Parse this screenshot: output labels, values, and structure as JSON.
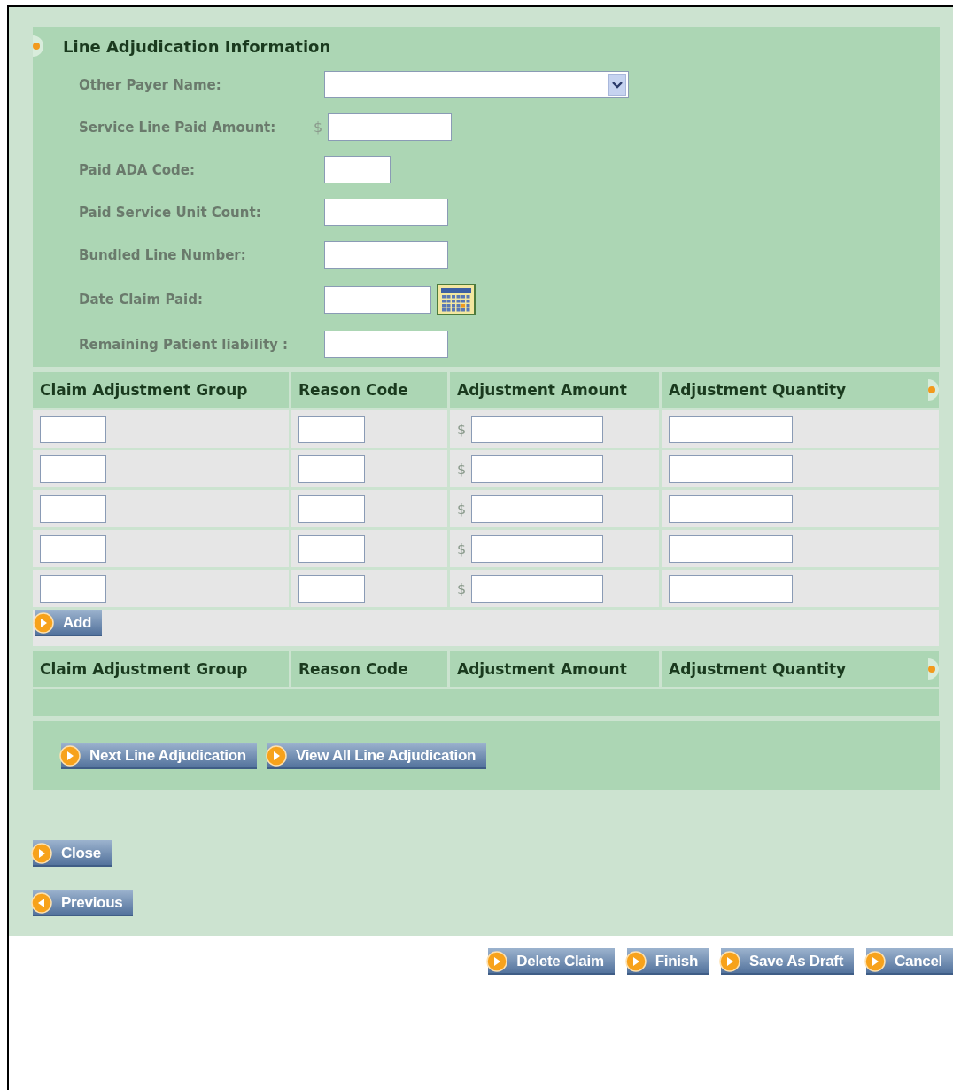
{
  "section": {
    "title": "Line Adjudication Information",
    "fields": [
      {
        "label": "Other Payer Name:",
        "kind": "select"
      },
      {
        "label": "Service Line Paid Amount:",
        "kind": "money",
        "prefix": "$"
      },
      {
        "label": "Paid ADA Code:",
        "kind": "short"
      },
      {
        "label": "Paid Service Unit Count:",
        "kind": "text"
      },
      {
        "label": "Bundled Line Number:",
        "kind": "text"
      },
      {
        "label": "Date Claim Paid:",
        "kind": "date"
      },
      {
        "label": "Remaining Patient liability :",
        "kind": "text"
      }
    ]
  },
  "adjustments": {
    "columns": [
      "Claim Adjustment Group",
      "Reason Code",
      "Adjustment Amount",
      "Adjustment Quantity"
    ],
    "rows": [
      {
        "cells": [
          {
            "kind": "short"
          },
          {
            "kind": "short"
          },
          {
            "kind": "money",
            "prefix": "$"
          },
          {
            "kind": "text"
          }
        ]
      },
      {
        "cells": [
          {
            "kind": "short"
          },
          {
            "kind": "short"
          },
          {
            "kind": "money",
            "prefix": "$"
          },
          {
            "kind": "text"
          }
        ]
      },
      {
        "cells": [
          {
            "kind": "short"
          },
          {
            "kind": "short"
          },
          {
            "kind": "money",
            "prefix": "$"
          },
          {
            "kind": "text"
          }
        ]
      },
      {
        "cells": [
          {
            "kind": "short"
          },
          {
            "kind": "short"
          },
          {
            "kind": "money",
            "prefix": "$"
          },
          {
            "kind": "text"
          }
        ]
      },
      {
        "cells": [
          {
            "kind": "short"
          },
          {
            "kind": "short"
          },
          {
            "kind": "money",
            "prefix": "$"
          },
          {
            "kind": "text"
          }
        ]
      }
    ],
    "add_button": {
      "label": "Add",
      "kind": "forward"
    }
  },
  "summary": {
    "columns": [
      "Claim Adjustment Group",
      "Reason Code",
      "Adjustment Amount",
      "Adjustment Quantity"
    ]
  },
  "line_buttons": [
    {
      "label": "Next Line Adjudication",
      "kind": "forward"
    },
    {
      "label": "View All Line Adjudication",
      "kind": "forward"
    }
  ],
  "nav_buttons": [
    {
      "label": "Close",
      "kind": "forward"
    },
    {
      "label": "Previous",
      "kind": "back"
    }
  ],
  "footer_buttons": [
    {
      "label": "Delete Claim",
      "kind": "forward"
    },
    {
      "label": "Finish",
      "kind": "forward"
    },
    {
      "label": "Save As Draft",
      "kind": "forward"
    },
    {
      "label": "Cancel",
      "kind": "forward"
    }
  ]
}
